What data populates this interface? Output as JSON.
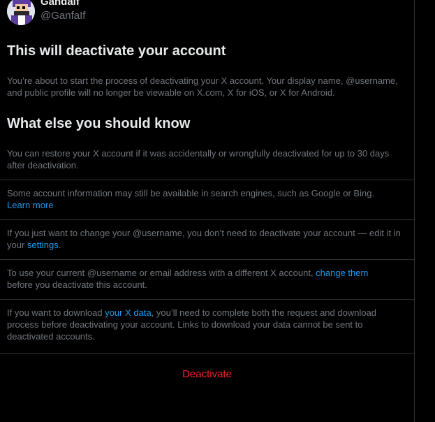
{
  "profile": {
    "name": "Gandalf",
    "handle": "@GanfaIf"
  },
  "heading": "This will deactivate your account",
  "intro": "You’re about to start the process of deactivating your X account. Your display name, @username, and public profile will no longer be viewable on X.com, X for iOS, or X for Android.",
  "section_title": "What else you should know",
  "items": {
    "restore": "You can restore your X account if it was accidentally or wrongfully deactivated for up to 30 days after deactivation.",
    "search_pre": "Some account information may still be available in search engines, such as Google or Bing.",
    "search_link": "Learn more",
    "username_pre": "If you just want to change your @username, you don’t need to deactivate your account — edit it in your ",
    "username_link": "settings",
    "username_post": ".",
    "email_pre": "To use your current @username or email address with a different X account, ",
    "email_link": "change them",
    "email_post": " before you deactivate this account.",
    "data_pre": "If you want to download ",
    "data_link": "your X data",
    "data_post": ", you’ll need to complete both the request and download process before deactivating your account. Links to download your data cannot be sent to deactivated accounts."
  },
  "deactivate_label": "Deactivate",
  "colors": {
    "background": "#000000",
    "text": "#e7e9ea",
    "muted": "#71767b",
    "link": "#1d9bf0",
    "danger": "#f4212e",
    "divider": "#2f3336"
  }
}
